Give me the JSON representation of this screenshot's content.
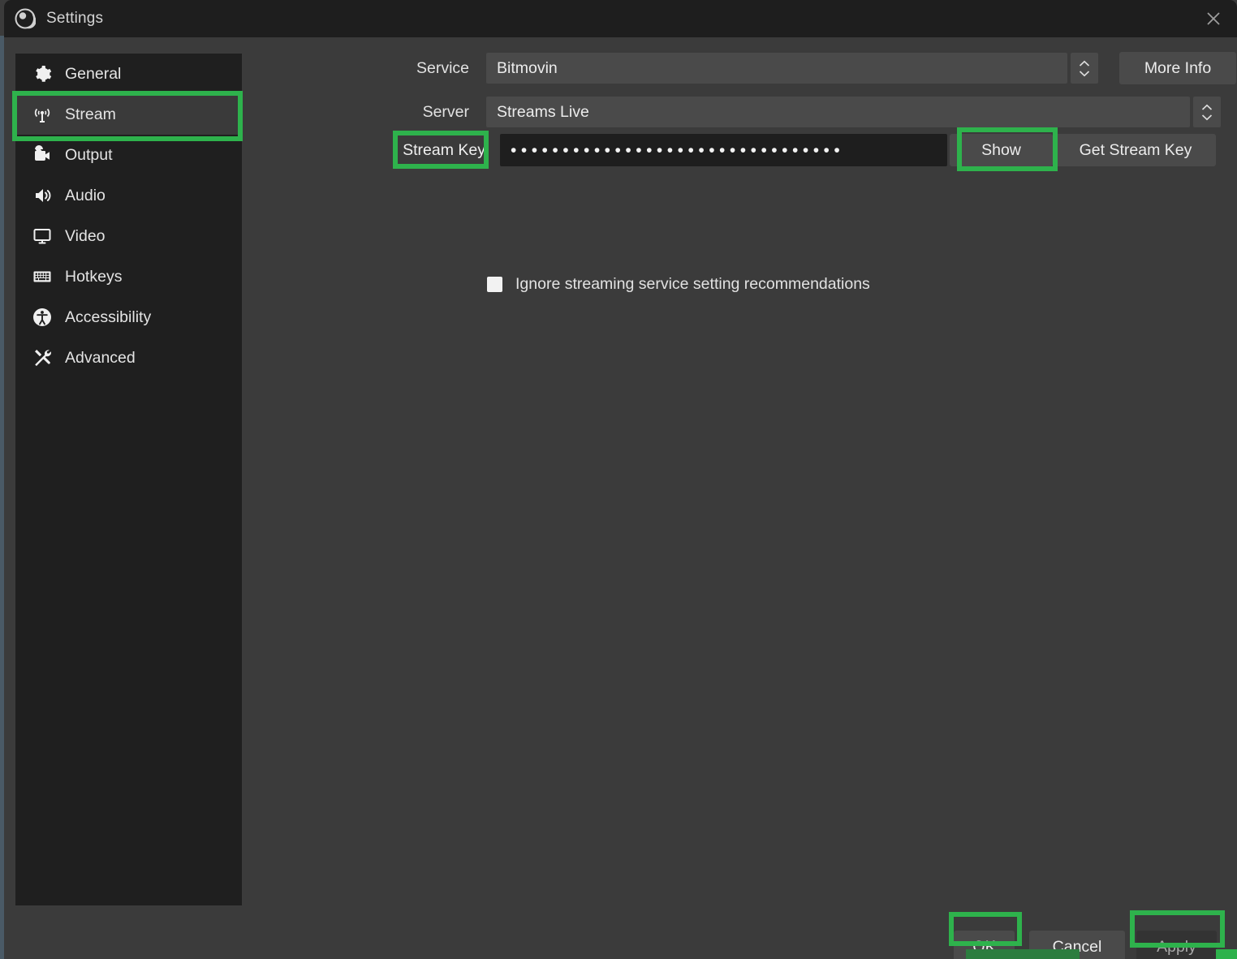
{
  "window": {
    "title": "Settings",
    "app_icon": "obs-logo-icon",
    "close_icon": "close-icon"
  },
  "sidebar": {
    "items": [
      {
        "label": "General",
        "icon": "gear-icon",
        "selected": false
      },
      {
        "label": "Stream",
        "icon": "broadcast-icon",
        "selected": true
      },
      {
        "label": "Output",
        "icon": "video-camera-icon",
        "selected": false
      },
      {
        "label": "Audio",
        "icon": "speaker-icon",
        "selected": false
      },
      {
        "label": "Video",
        "icon": "monitor-icon",
        "selected": false
      },
      {
        "label": "Hotkeys",
        "icon": "keyboard-icon",
        "selected": false
      },
      {
        "label": "Accessibility",
        "icon": "accessibility-icon",
        "selected": false
      },
      {
        "label": "Advanced",
        "icon": "tools-icon",
        "selected": false
      }
    ]
  },
  "form": {
    "service": {
      "label": "Service",
      "value": "Bitmovin",
      "stepper_icon": "up-down-chevron-icon",
      "more_info_label": "More Info"
    },
    "server": {
      "label": "Server",
      "value": "Streams Live",
      "stepper_icon": "up-down-chevron-icon"
    },
    "stream_key": {
      "label": "Stream Key",
      "masked_value": "••••••••••••••••••••••••••••••••",
      "show_label": "Show",
      "get_key_label": "Get Stream Key"
    },
    "ignore_recommendations": {
      "label": "Ignore streaming service setting recommendations",
      "checked": false
    }
  },
  "footer": {
    "ok_label": "OK",
    "cancel_label": "Cancel",
    "apply_label": "Apply"
  },
  "colors": {
    "highlight_green": "#2eb24c",
    "sidebar_bg": "#1f1f1f",
    "panel_bg": "#3b3b3b",
    "titlebar_bg": "#1e1e1e",
    "control_bg": "#4a4a4a",
    "field_bg": "#1e1e1e"
  }
}
